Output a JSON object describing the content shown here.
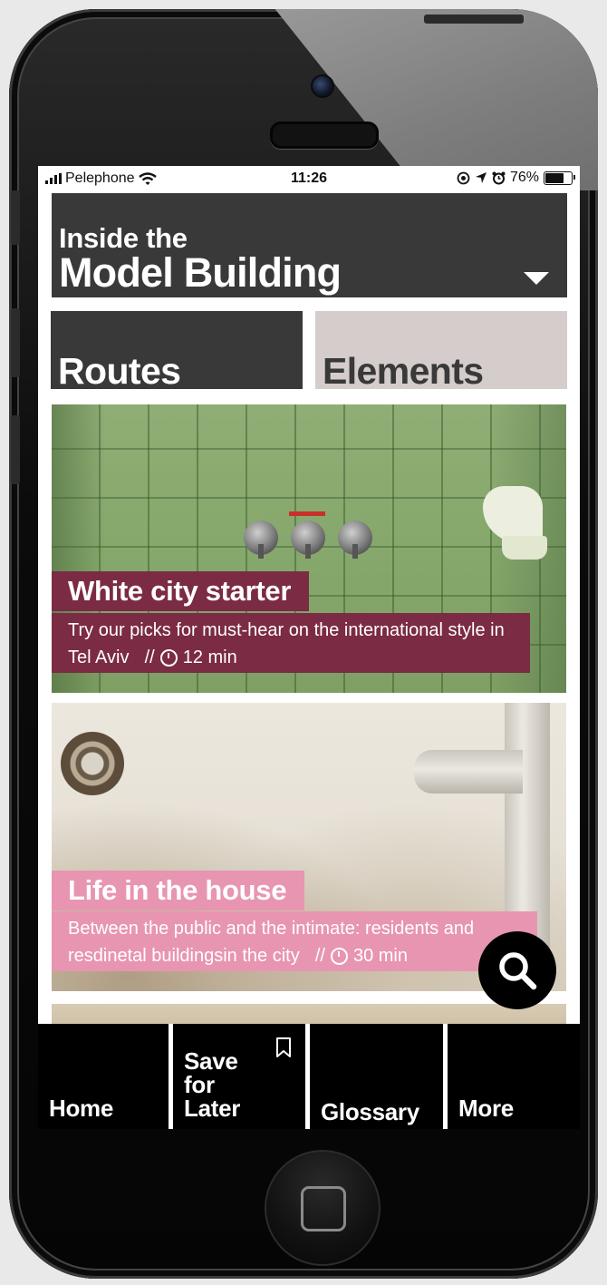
{
  "status_bar": {
    "carrier": "Pelephone",
    "time": "11:26",
    "battery": "76%",
    "battery_level": 0.76
  },
  "header": {
    "kicker": "Inside the",
    "title": "Model Building",
    "dropdown_icon": "caret-down-icon"
  },
  "tabs": [
    {
      "label": "Routes",
      "selected": true
    },
    {
      "label": "Elements",
      "selected": false
    }
  ],
  "cards": [
    {
      "title": "White city starter",
      "description": "Try our picks for must-hear on the international style in Tel Aviv",
      "separator": "//",
      "duration": "12 min",
      "color": "#7b2b43"
    },
    {
      "title": "Life in the house",
      "description": "Between the public and the intimate: residents and resdinetal buildingsin the city",
      "separator": "//",
      "duration": "30 min",
      "color": "#e895b1"
    }
  ],
  "search_button": {
    "icon": "search-icon"
  },
  "bottom_nav": [
    {
      "label": "Home"
    },
    {
      "label": "Save for Later",
      "icon": "bookmark-icon"
    },
    {
      "label": "Glossary"
    },
    {
      "label": "More"
    }
  ],
  "colors": {
    "header_bg": "#3a393a",
    "tab_inactive_bg": "#d4cdcc",
    "nav_bg": "#000000"
  }
}
